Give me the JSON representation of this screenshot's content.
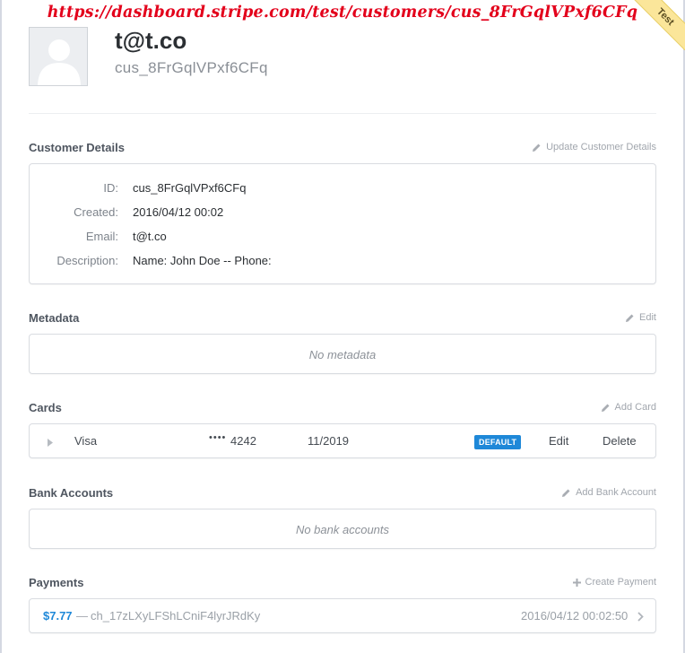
{
  "url_overlay": "https://dashboard.stripe.com/test/customers/cus_8FrGqlVPxf6CFq",
  "test_ribbon": "Test",
  "header": {
    "email": "t@t.co",
    "customer_id": "cus_8FrGqlVPxf6CFq"
  },
  "customer_details": {
    "title": "Customer Details",
    "action": "Update Customer Details",
    "rows": [
      {
        "label": "ID:",
        "value": "cus_8FrGqlVPxf6CFq"
      },
      {
        "label": "Created:",
        "value": "2016/04/12 00:02"
      },
      {
        "label": "Email:",
        "value": "t@t.co"
      },
      {
        "label": "Description:",
        "value": "Name: John Doe -- Phone:"
      }
    ]
  },
  "metadata": {
    "title": "Metadata",
    "action": "Edit",
    "empty": "No metadata"
  },
  "cards": {
    "title": "Cards",
    "action": "Add Card",
    "items": [
      {
        "brand": "Visa",
        "dots": "••••",
        "last4": "4242",
        "expiry": "11/2019",
        "badge": "DEFAULT",
        "edit": "Edit",
        "delete": "Delete"
      }
    ]
  },
  "bank_accounts": {
    "title": "Bank Accounts",
    "action": "Add Bank Account",
    "empty": "No bank accounts"
  },
  "payments": {
    "title": "Payments",
    "action": "Create Payment",
    "items": [
      {
        "amount": "$7.77",
        "separator": "—",
        "charge_id": "ch_17zLXyLFShLCniF4lyrJRdKy",
        "date": "2016/04/12 00:02:50"
      }
    ]
  },
  "colors": {
    "accent": "#1e88d8",
    "url_overlay": "#e3001b",
    "ribbon": "#fbe69a"
  },
  "icons": {
    "update": "pencil-icon",
    "edit": "pencil-icon",
    "add_card": "pencil-icon",
    "add_bank": "pencil-icon",
    "create_payment": "plus-icon",
    "expand": "triangle-right-icon",
    "open": "chevron-right-icon",
    "avatar": "default-avatar-icon"
  }
}
